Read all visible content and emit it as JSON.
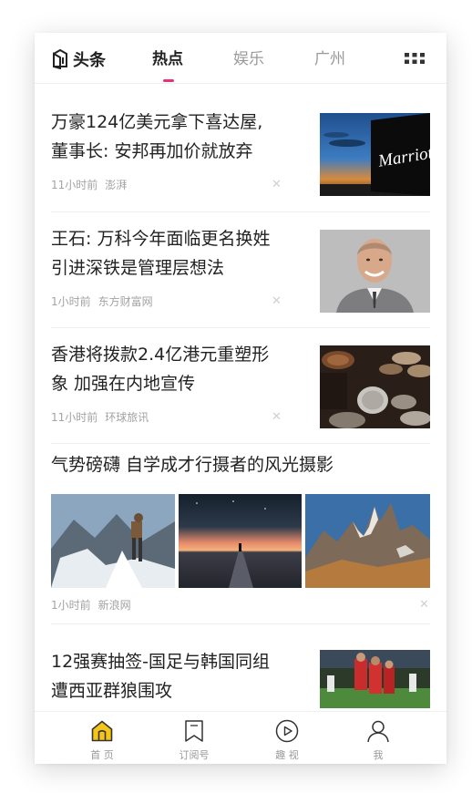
{
  "header": {
    "logo_text": "头条",
    "tabs": [
      {
        "label": "热点",
        "active": true
      },
      {
        "label": "娱乐",
        "active": false
      },
      {
        "label": "广州",
        "active": false
      }
    ],
    "accent_color": "#e9307e"
  },
  "feed": [
    {
      "title_line1": "万豪124亿美元拿下喜达屋,",
      "title_line2": "董事长: 安邦再加价就放弃",
      "time": "11小时前",
      "source": "澎湃",
      "thumbnail": "marriott-sign-photo"
    },
    {
      "title_line1": "王石: 万科今年面临更名换姓",
      "title_line2": "引进深铁是管理层想法",
      "time": "1小时前",
      "source": "东方财富网",
      "thumbnail": "portrait-photo"
    },
    {
      "title_line1": "香港将拨款2.4亿港元重塑形",
      "title_line2": "象 加强在内地宣传",
      "time": "11小时前",
      "source": "环球旅讯",
      "thumbnail": "coins-photo"
    },
    {
      "title_line1": "气势磅礴 自学成才行摄者的风光摄影",
      "time": "1小时前",
      "source": "新浪网",
      "thumbnails": [
        "mountain-climber-photo",
        "sunset-road-photo",
        "rocky-peaks-photo"
      ]
    },
    {
      "title_line1": "12强赛抽签-国足与韩国同组",
      "title_line2": "遭西亚群狼围攻",
      "thumbnail": "football-players-photo"
    }
  ],
  "tabbar": {
    "items": [
      {
        "label": "首 页",
        "icon": "home-icon",
        "active": true
      },
      {
        "label": "订阅号",
        "icon": "bookmark-icon",
        "active": false
      },
      {
        "label": "趣 视",
        "icon": "play-icon",
        "active": false
      },
      {
        "label": "我",
        "icon": "person-icon",
        "active": false
      }
    ],
    "active_color": "#f5c518"
  }
}
